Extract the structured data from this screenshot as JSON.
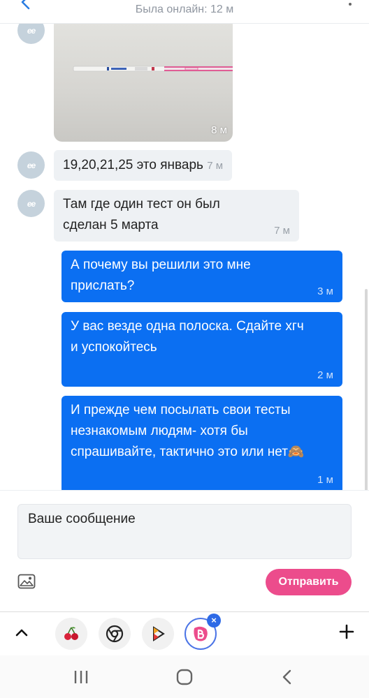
{
  "header": {
    "status": "Была онлайн: 12 м"
  },
  "messages": {
    "photo": {
      "time": "8 м"
    },
    "in_1": {
      "avatar": "ee",
      "text": "19,20,21,25 это январь",
      "time": "7 м"
    },
    "in_2": {
      "avatar": "ee",
      "line1": "Там где один тест он был",
      "line2": "сделан 5 марта",
      "time": "7 м"
    },
    "out_1": {
      "line1": "А почему вы решили это мне",
      "line2": "прислать?",
      "time": "3 м"
    },
    "out_2": {
      "line1": "У вас везде одна полоска. Сдайте хгч",
      "line2": "и успокойтесь",
      "time": "2 м"
    },
    "out_3": {
      "line1": "И прежде чем посылать свои тесты",
      "line2": "незнакомым людям- хотя бы",
      "line3": "спрашивайте, тактично это или нет🙈",
      "time": "1 м"
    }
  },
  "compose": {
    "placeholder": "Ваше сообщение",
    "send_label": "Отправить"
  },
  "dock": {
    "apps": [
      "cherry-app",
      "chrome-app",
      "video-app",
      "baby-app"
    ],
    "close_badge": "×"
  },
  "colors": {
    "outgoing_bubble": "#0b6ff2",
    "incoming_bubble": "#eef1f4",
    "send_button": "#ec4c8c",
    "accent": "#4b74e6"
  }
}
